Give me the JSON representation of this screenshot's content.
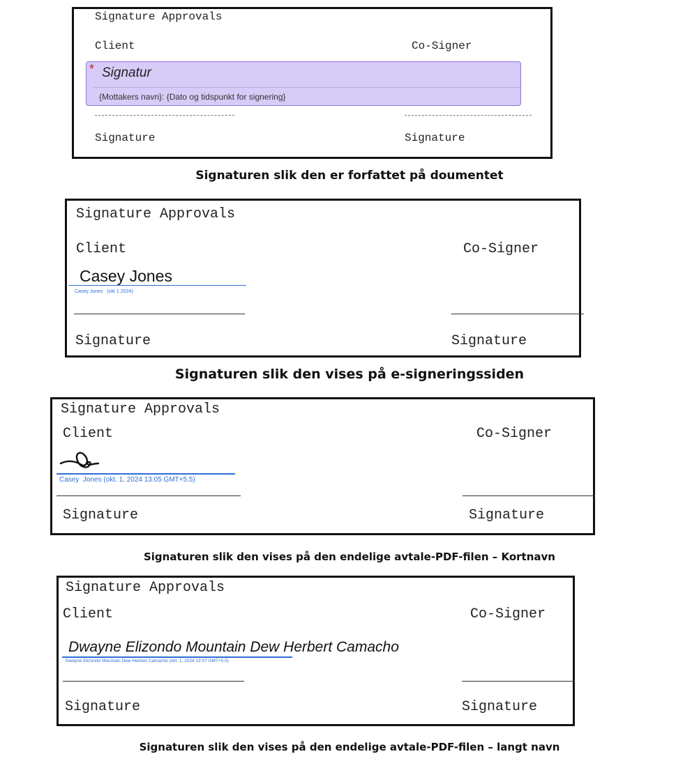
{
  "panels": [
    {
      "heading": "Signature Approvals",
      "client_label": "Client",
      "cosigner_label": "Co-Signer",
      "signature_label_left": "Signature",
      "signature_label_right": "Signature",
      "field": {
        "required_marker": "*",
        "label": "Signatur",
        "hint": "{Mottakers navn}: {Dato og tidspunkt for signering}",
        "fill_color": "#d7cbf7",
        "border_color": "#8e72d8"
      },
      "caption": "Signaturen slik den er forfattet på doumentet"
    },
    {
      "heading": "Signature Approvals",
      "client_label": "Client",
      "cosigner_label": "Co-Signer",
      "signature_label_left": "Signature",
      "signature_label_right": "Signature",
      "signed_name": "Casey Jones",
      "stamp": "Casey Jones   (okt 1 2024)",
      "caption": "Signaturen slik den vises på e-signeringssiden"
    },
    {
      "heading": "Signature Approvals",
      "client_label": "Client",
      "cosigner_label": "Co-Signer",
      "signature_label_left": "Signature",
      "signature_label_right": "Signature",
      "signature_image": "handwritten-signature",
      "stamp": "Casey  Jones (okt. 1, 2024 13:05 GMT+5.5)",
      "caption": "Signaturen slik den vises på den endelige avtale-PDF-filen – Kortnavn"
    },
    {
      "heading": "Signature Approvals",
      "client_label": "Client",
      "cosigner_label": "Co-Signer",
      "signature_label_left": "Signature",
      "signature_label_right": "Signature",
      "signed_name": "Dwayne Elizondo Mountain Dew Herbert Camacho",
      "stamp": "Dwayne Elizondo Mountain Dew Herbert Camacho (okt. 1, 2024 13:07 GMT+5.5)",
      "caption": "Signaturen slik den vises på den endelige avtale-PDF-filen – langt navn"
    }
  ],
  "colors": {
    "stamp_blue": "#2f6fd6",
    "required_red": "#c0202a"
  }
}
